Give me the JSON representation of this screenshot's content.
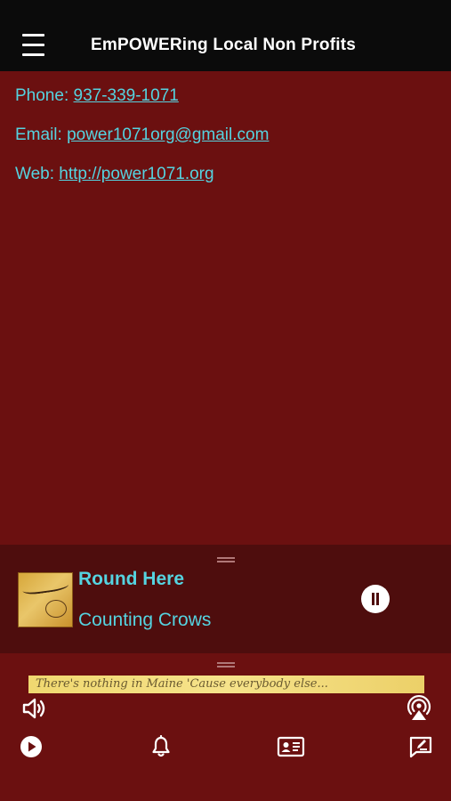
{
  "header": {
    "title": "EmPOWERing Local Non Profits"
  },
  "contact": {
    "phone_label": "Phone: ",
    "phone": "937-339-1071",
    "email_label": "Email: ",
    "email": "power1071org@gmail.com",
    "web_label": "Web: ",
    "web": "http://power1071.org"
  },
  "player": {
    "track_title": "Round Here",
    "track_artist": "Counting Crows",
    "album_art": "Counting Crows album cover"
  },
  "ticker": {
    "text": "There's nothing in Maine 'Cause everybody else..."
  },
  "toolbar": {
    "left_top_icon": "speaker-volume-icon",
    "right_top_icon": "airplay-broadcast-icon"
  },
  "bottom_nav": {
    "items": [
      {
        "icon": "play-circle-icon"
      },
      {
        "icon": "bell-icon"
      },
      {
        "icon": "contact-card-icon"
      },
      {
        "icon": "message-edit-icon"
      }
    ]
  },
  "colors": {
    "background": "#6b1010",
    "header": "#0b0b0b",
    "player": "#4e0d0d",
    "accent_text": "#55d3e0"
  }
}
